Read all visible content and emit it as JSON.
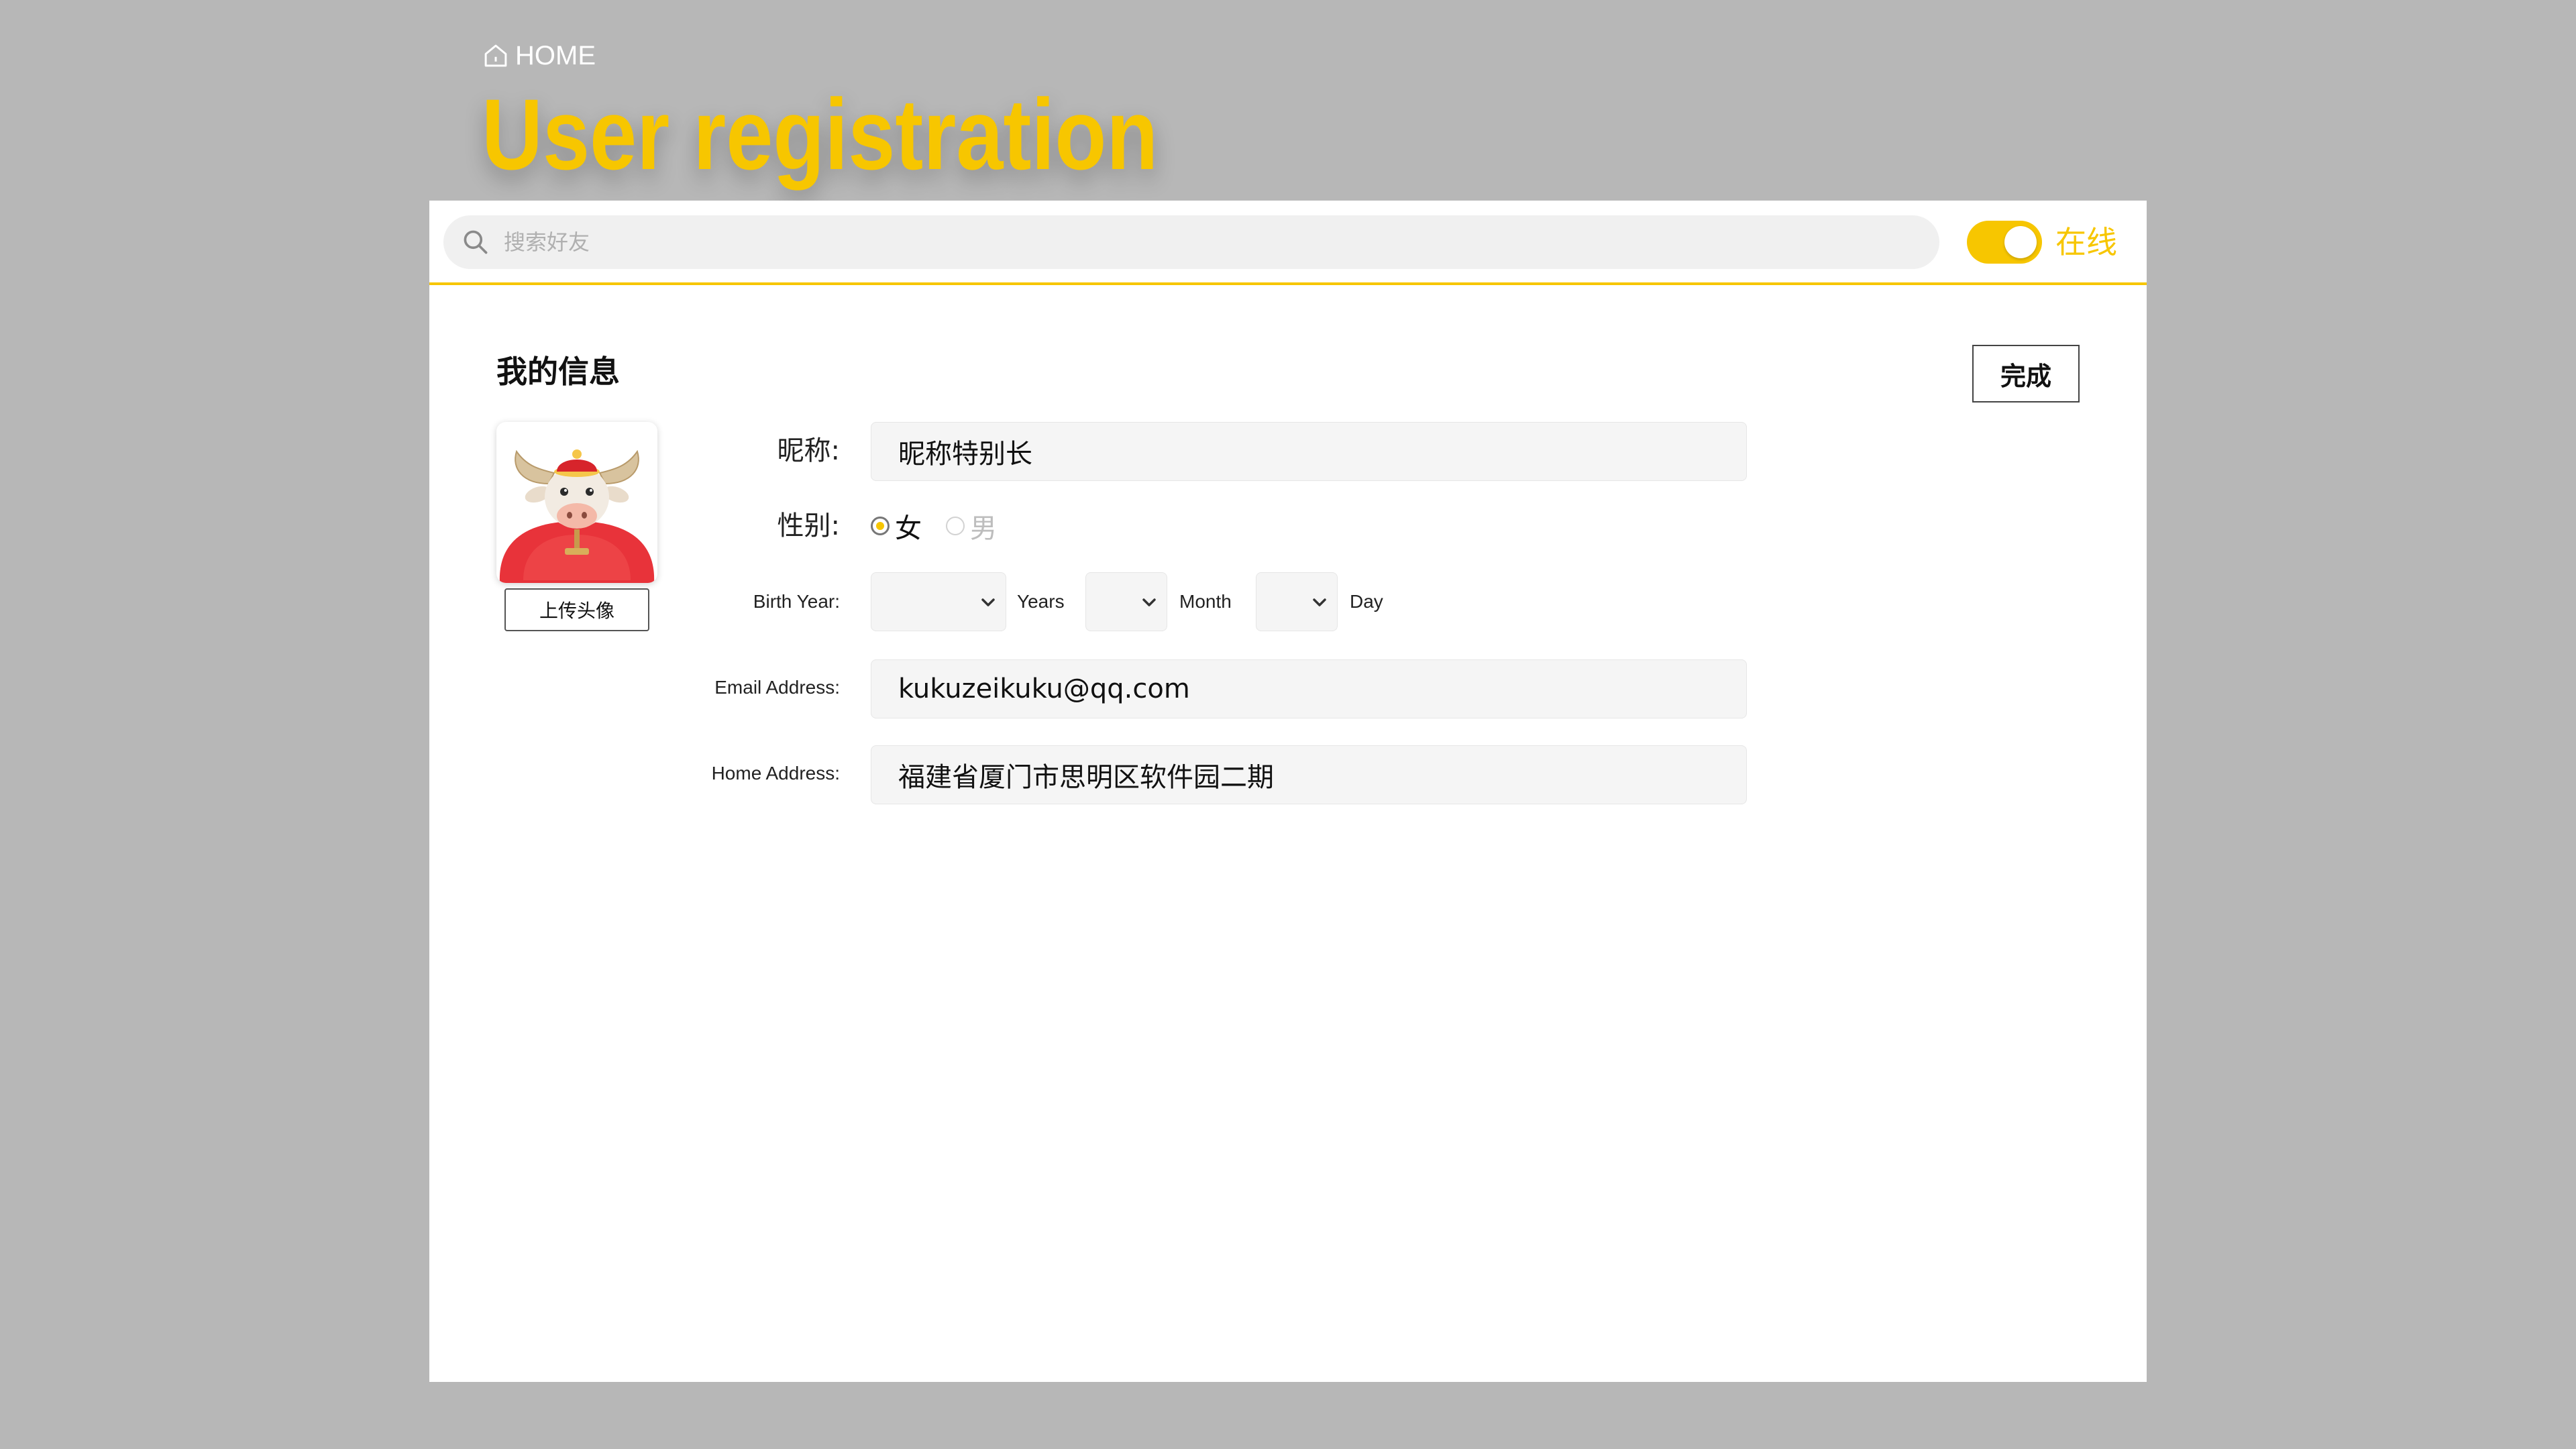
{
  "breadcrumb": {
    "icon": "home-icon",
    "label": "HOME"
  },
  "page": {
    "title": "User registration"
  },
  "topbar": {
    "search_placeholder": "搜索好友",
    "search_icon": "search-icon",
    "status_toggle_on": true,
    "status_label": "在线"
  },
  "form": {
    "section_title": "我的信息",
    "done_label": "完成",
    "upload_label": "上传头像",
    "nickname_label": "昵称:",
    "nickname_value": "昵称特别长",
    "gender_label": "性别:",
    "gender_options": [
      "女",
      "男"
    ],
    "gender_selected": "女",
    "birth_label": "Birth Year:",
    "birth_units": [
      "Years",
      "Month",
      "Day"
    ],
    "email_label": "Email Address:",
    "email_value": "kukuzeikuku@qq.com",
    "address_label": "Home Address:",
    "address_value": "福建省厦门市思明区软件园二期"
  },
  "colors": {
    "accent": "#f7c600",
    "background": "#b7b7b7",
    "panel": "#ffffff",
    "field_bg": "#f5f5f5"
  }
}
